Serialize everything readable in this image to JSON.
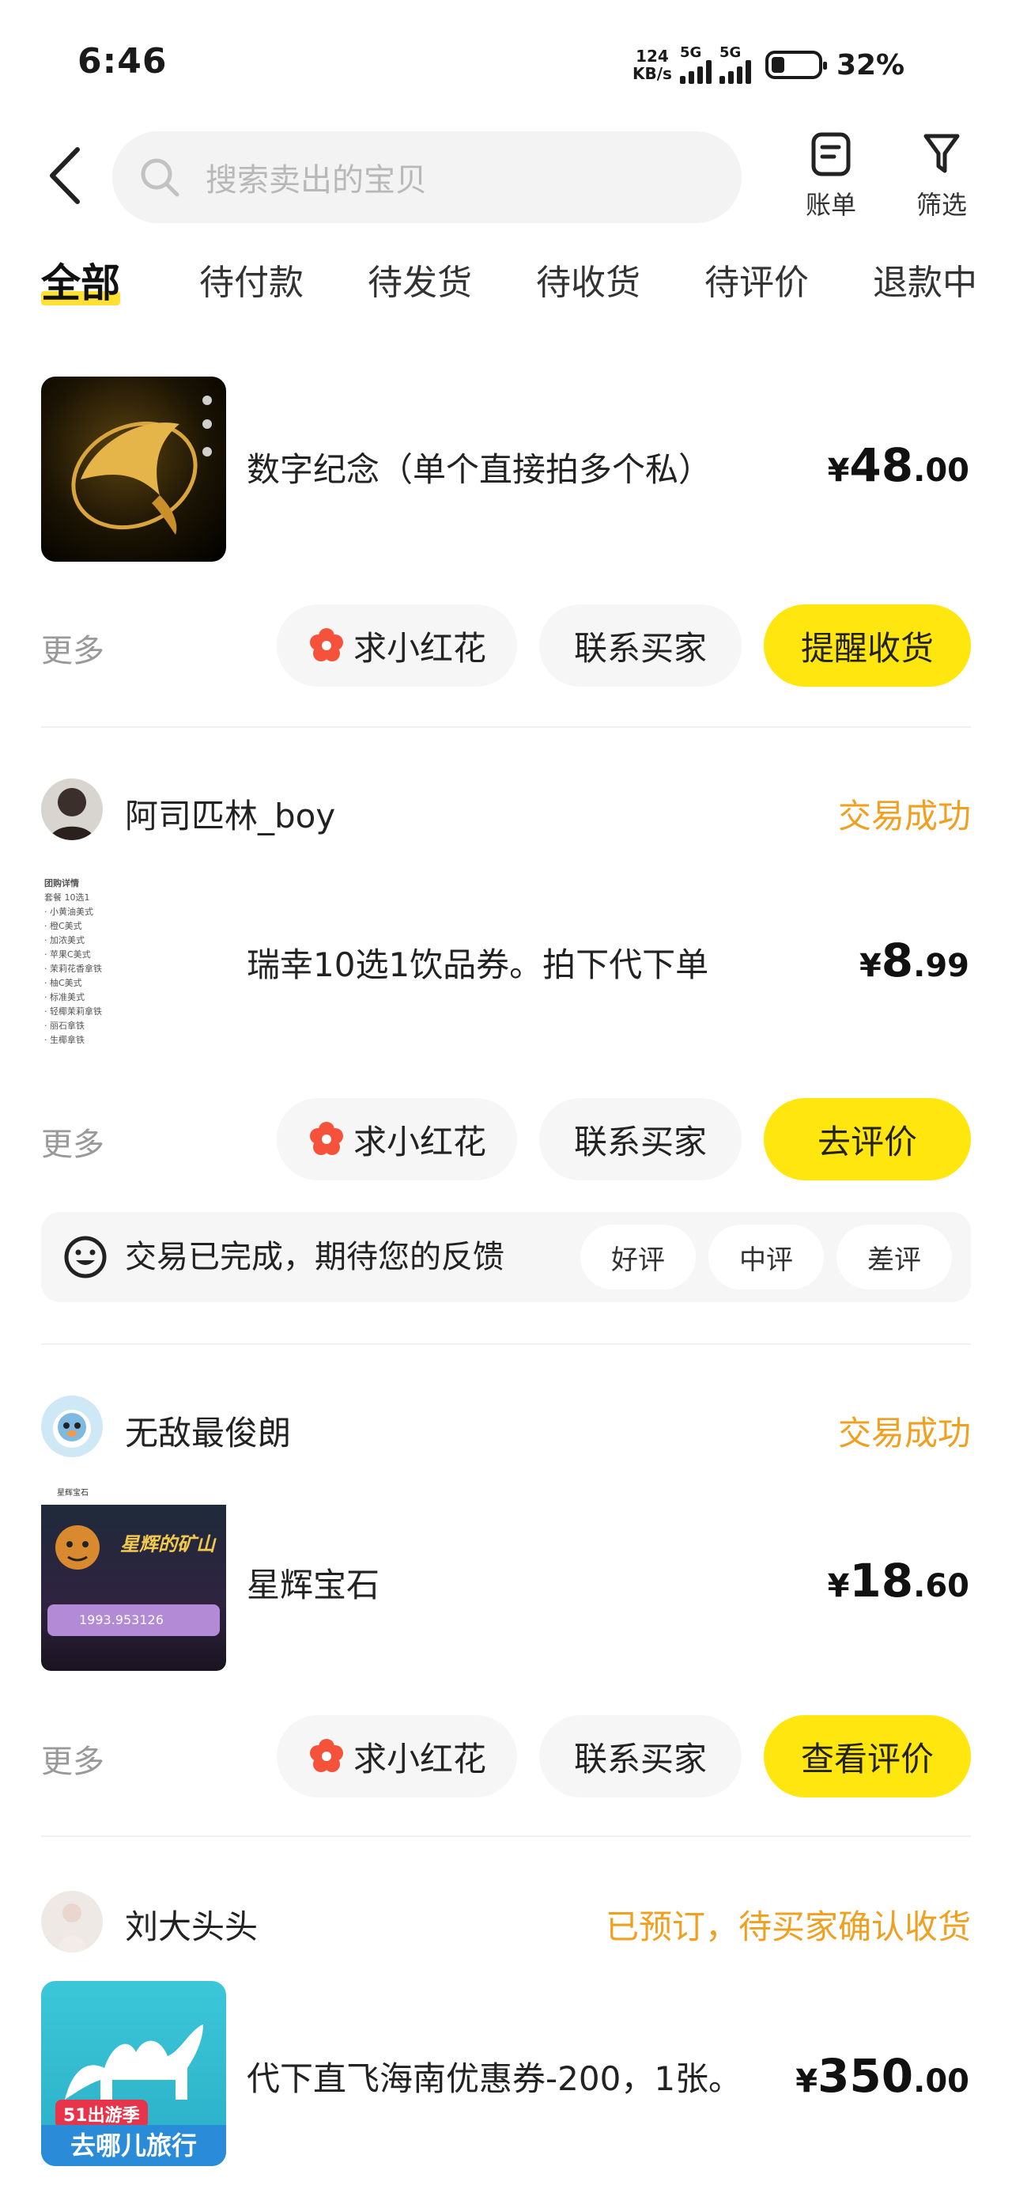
{
  "status_bar": {
    "time": "6:46",
    "net_speed_value": "124",
    "net_speed_unit": "KB/s",
    "sim1": "5G",
    "sim2": "5G",
    "battery_percent": "32%"
  },
  "header": {
    "search_placeholder": "搜索卖出的宝贝",
    "bill_label": "账单",
    "filter_label": "筛选"
  },
  "tabs": [
    "全部",
    "待付款",
    "待发货",
    "待收货",
    "待评价",
    "退款中"
  ],
  "orders": [
    {
      "title": "数字纪念（单个直接拍多个私）",
      "price_currency": "¥",
      "price_int": "48",
      "price_dec": ".00",
      "more": "更多",
      "btn_flower": "求小红花",
      "btn_contact": "联系买家",
      "btn_primary": "提醒收货"
    },
    {
      "seller": "阿司匹林_boy",
      "status": "交易成功",
      "thumb_lines": [
        "团购详情",
        "套餐 10选1",
        "· 小黄油美式",
        "· 橙C美式",
        "· 加浓美式",
        "· 苹果C美式",
        "· 茉莉花香拿铁",
        "· 柚C美式",
        "· 标准美式",
        "· 轻椰茉莉拿铁",
        "· 丽石拿铁",
        "· 生椰拿铁"
      ],
      "title": "瑞幸10选1饮品券。拍下代下单",
      "price_currency": "¥",
      "price_int": "8",
      "price_dec": ".99",
      "more": "更多",
      "btn_flower": "求小红花",
      "btn_contact": "联系买家",
      "btn_primary": "去评价",
      "feedback": {
        "message": "交易已完成，期待您的反馈",
        "good": "好评",
        "neutral": "中评",
        "bad": "差评"
      }
    },
    {
      "seller": "无敌最俊朗",
      "status": "交易成功",
      "thumb_game_title": "星辉宝石",
      "thumb_banner": "星辉的矿山",
      "thumb_value": "1993.953126",
      "title": "星辉宝石",
      "price_currency": "¥",
      "price_int": "18",
      "price_dec": ".60",
      "more": "更多",
      "btn_flower": "求小红花",
      "btn_contact": "联系买家",
      "btn_primary": "查看评价"
    },
    {
      "seller": "刘大头头",
      "status": "已预订，待买家确认收货",
      "thumb_badge": "51出游季",
      "thumb_brand": "去哪儿旅行",
      "title": "代下直飞海南优惠券-200，1张。",
      "price_currency": "¥",
      "price_int": "350",
      "price_dec": ".00"
    }
  ],
  "colors": {
    "accent_yellow": "#ffe60f",
    "status_orange": "#f0a020",
    "flower_red": "#f5523c"
  }
}
